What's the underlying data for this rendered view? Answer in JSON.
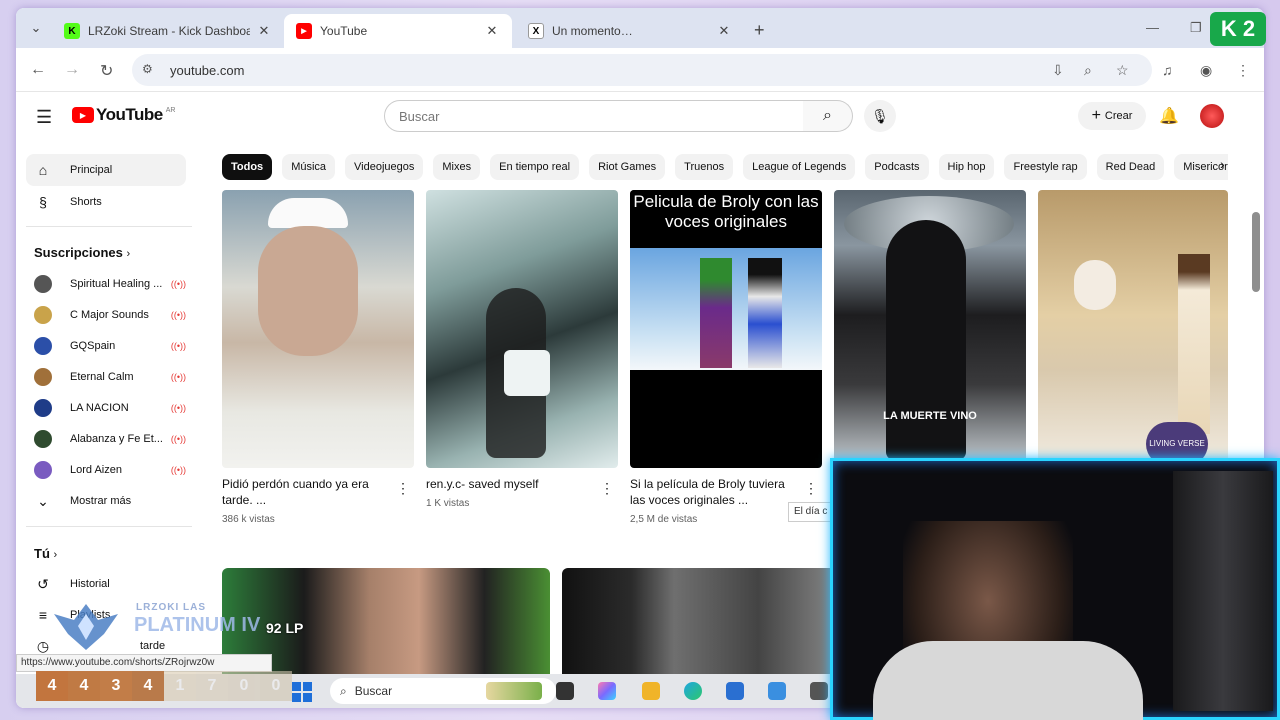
{
  "browser": {
    "tabs": [
      {
        "title": "LRZoki Stream - Kick Dashboard",
        "favicon": "kick-icon",
        "color": "#53fc18"
      },
      {
        "title": "YouTube",
        "favicon": "youtube-icon",
        "color": "#ff0000",
        "active": true
      },
      {
        "title": "Un momento…",
        "favicon": "x-icon",
        "color": "#000000"
      }
    ],
    "url": "youtube.com"
  },
  "youtube": {
    "logo_text": "YouTube",
    "country_code": "AR",
    "search_placeholder": "Buscar",
    "create_label": "Crear",
    "sidebar": {
      "main": [
        {
          "label": "Principal",
          "icon": "home-icon",
          "active": true
        },
        {
          "label": "Shorts",
          "icon": "shorts-icon"
        }
      ],
      "subscriptions_title": "Suscripciones",
      "subscriptions": [
        {
          "label": "Spiritual Healing ...",
          "color": "#555555"
        },
        {
          "label": "C Major Sounds",
          "color": "#c9a34a"
        },
        {
          "label": "GQSpain",
          "color": "#2b4fa8"
        },
        {
          "label": "Eternal Calm",
          "color": "#a0703a"
        },
        {
          "label": "LA NACION",
          "color": "#1f3c88"
        },
        {
          "label": "Alabanza y Fe Et...",
          "color": "#2f4b2f"
        },
        {
          "label": "Lord Aizen",
          "color": "#7a5bc0"
        }
      ],
      "show_more": "Mostrar más",
      "you_title": "Tú",
      "you_items": [
        {
          "label": "Historial",
          "icon": "history-icon"
        },
        {
          "label": "Playlists",
          "icon": "playlist-icon"
        },
        {
          "label": "tarde",
          "icon": "clock-icon"
        }
      ]
    },
    "chips": [
      "Todos",
      "Música",
      "Videojuegos",
      "Mixes",
      "En tiempo real",
      "Riot Games",
      "Truenos",
      "League of Legends",
      "Podcasts",
      "Hip hop",
      "Freestyle rap",
      "Red Dead",
      "Misericordia"
    ],
    "videos": [
      {
        "title": "Pidió perdón cuando ya era tarde. ...",
        "views": "386 k vistas"
      },
      {
        "title": "ren.y.c- saved myself",
        "views": "1 K vistas"
      },
      {
        "title": "Si la película de Broly tuviera las voces originales ...",
        "views": "2,5 M de vistas",
        "overlay_text": "Pelicula de Broly con las voces originales"
      },
      {
        "title": "",
        "views": "",
        "overlay_text": "LA MUERTE VINO"
      },
      {
        "title": "",
        "views": "",
        "overlay_text": "LIVING VERSE"
      }
    ],
    "tooltip": "El día c",
    "status_url": "https://www.youtube.com/shorts/ZRojrwz0w"
  },
  "taskbar": {
    "search_label": "Buscar"
  },
  "stream_overlay": {
    "name": "LRZOKI LAS",
    "rank": "PLATINUM IV",
    "lp": "92 LP",
    "numbers": [
      "4",
      "4",
      "3",
      "4",
      "1",
      "7",
      "0",
      "0"
    ],
    "corner_badge": "K 2"
  }
}
